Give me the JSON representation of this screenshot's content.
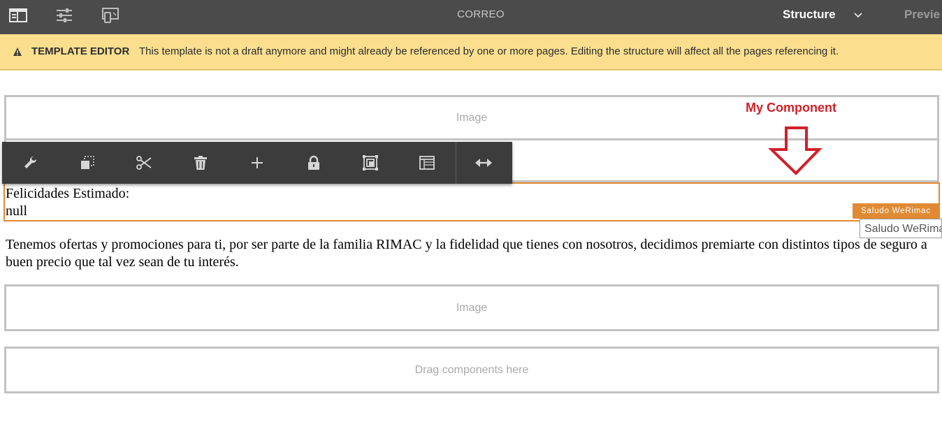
{
  "topbar": {
    "title": "CORREO",
    "mode_label": "Structure",
    "preview_label": "Previe"
  },
  "banner": {
    "label": "TEMPLATE EDITOR",
    "message": "This template is not a draft anymore and might already be referenced by one or more pages. Editing the structure will affect all the pages referencing it."
  },
  "annotation": {
    "text": "My Component"
  },
  "placeholders": {
    "image_1": "Image",
    "image_2": "Image",
    "drag": "Drag components here"
  },
  "selected_component": {
    "line_1": "Felicidades Estimado:",
    "line_2": "null",
    "tag": "Saludo WeRimac",
    "tooltip": "Saludo WeRimac"
  },
  "content": {
    "paragraph": "Tenemos ofertas y promociones para ti, por ser parte de la familia RIMAC y la fidelidad que tienes con nosotros, decidimos premiarte con distintos tipos de seguro a buen precio que tal vez sean de tu interés."
  },
  "toolbar": {
    "icons": [
      "wrench-icon",
      "copy-icon",
      "cut-icon",
      "trash-icon",
      "plus-icon",
      "lock-icon",
      "group-icon",
      "layout-icon",
      "resize-icon"
    ]
  },
  "colors": {
    "topbar": "#4b4b4b",
    "banner": "#fbdf8f",
    "selection": "#e08a34",
    "annotation": "#d21f2a",
    "toolbar": "#3c3c3c"
  }
}
